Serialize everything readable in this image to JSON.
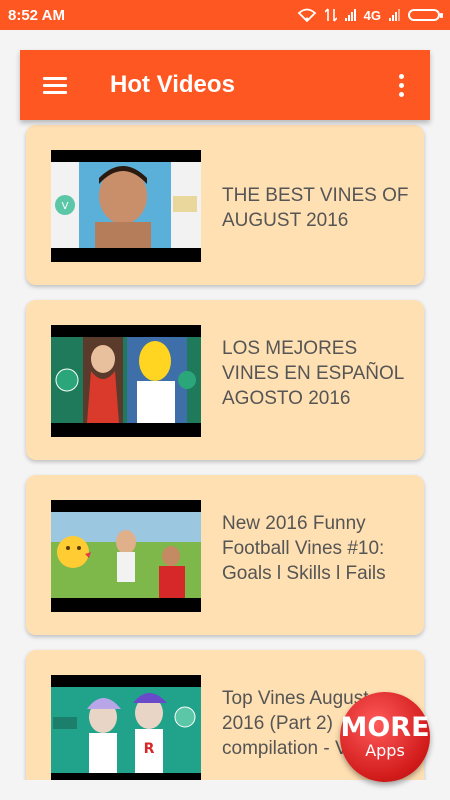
{
  "status_bar": {
    "time": "8:52 AM",
    "network": "4G"
  },
  "toolbar": {
    "title": "Hot Videos",
    "menu_icon": "hamburger-menu-icon",
    "overflow_icon": "more-vert-icon"
  },
  "videos": [
    {
      "title": "THE BEST VINES OF AUGUST 2016"
    },
    {
      "title": "LOS MEJORES VINES EN ESPAÑOL AGOSTO 2016"
    },
    {
      "title": "New 2016 Funny Football Vines #10: Goals l Skills l Fails"
    },
    {
      "title": "Top Vines August 2016 (Part 2) compilation - Vines✔"
    }
  ],
  "more_apps": {
    "line1": "MORE",
    "line2": "Apps"
  },
  "colors": {
    "primary": "#ff5722",
    "card": "#ffe0b2",
    "badge": "#d11a1a"
  }
}
